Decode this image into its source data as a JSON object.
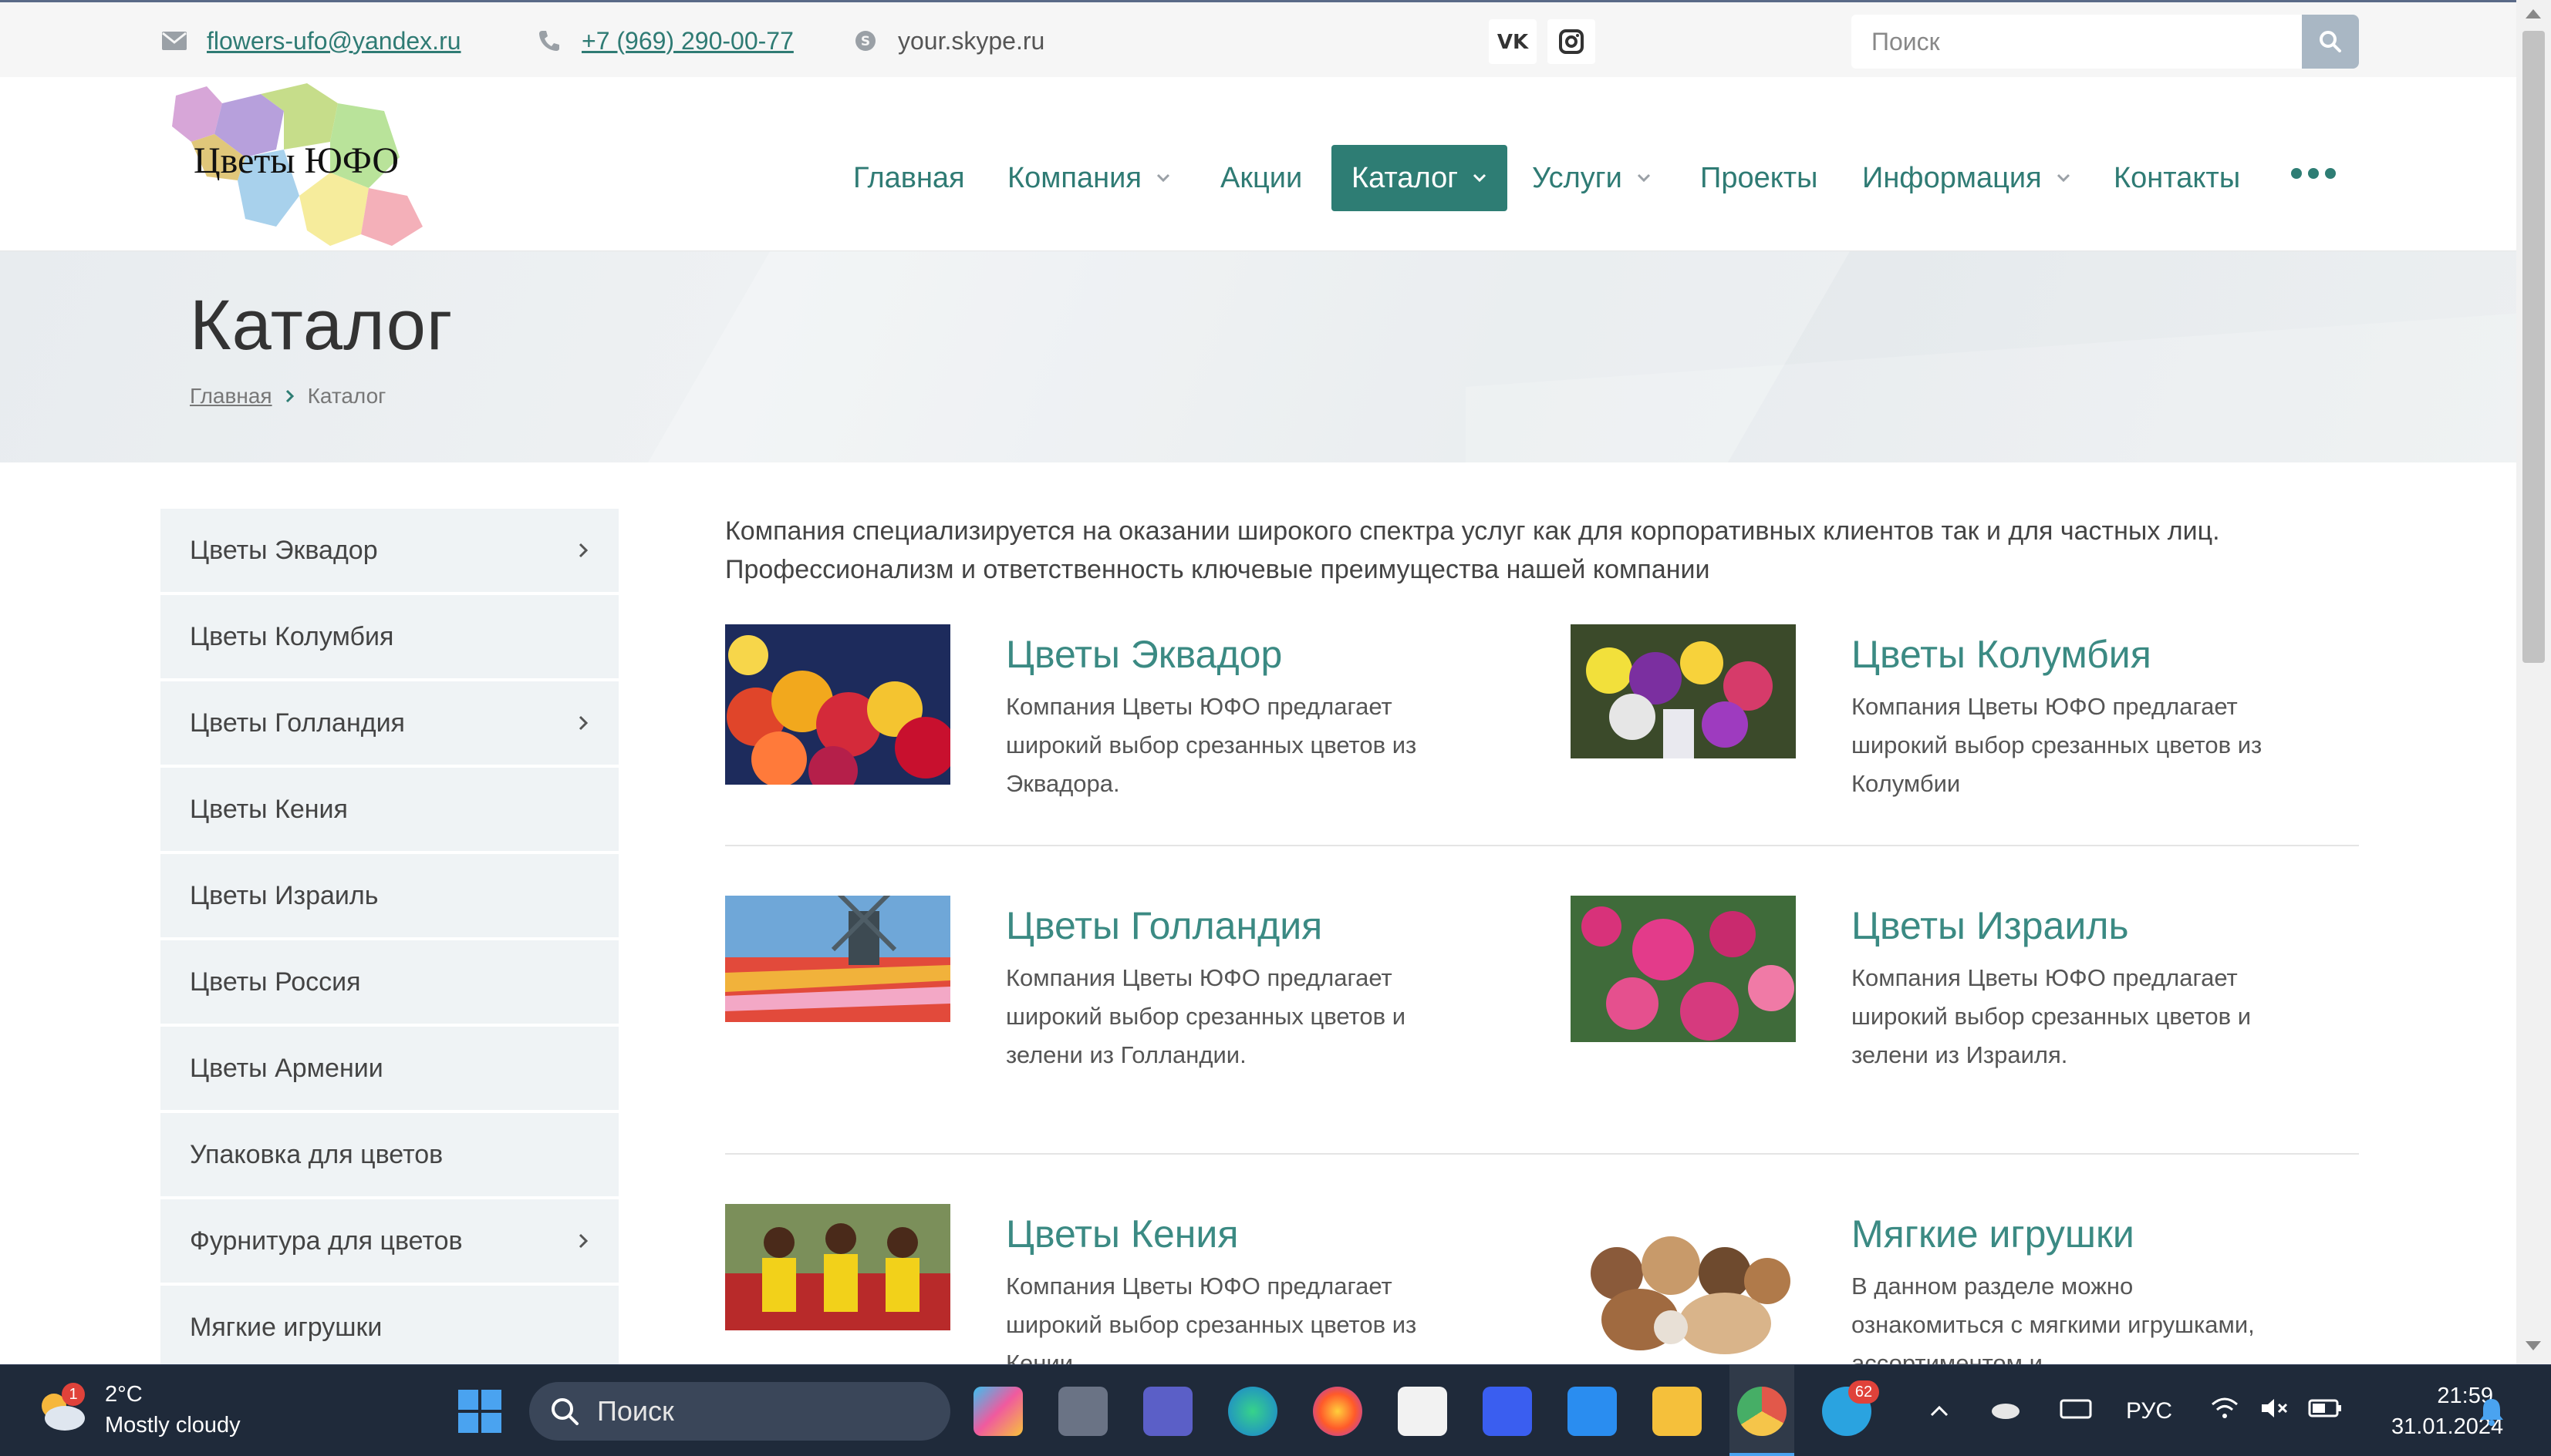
{
  "topbar": {
    "email": "flowers-ufo@yandex.ru",
    "phone": "+7 (969) 290-00-77",
    "skype": "your.skype.ru",
    "search_placeholder": "Поиск"
  },
  "logo_text": "Цветы ЮФО",
  "nav": {
    "items": [
      {
        "label": "Главная"
      },
      {
        "label": "Компания"
      },
      {
        "label": "Акции"
      },
      {
        "label": "Каталог"
      },
      {
        "label": "Услуги"
      },
      {
        "label": "Проекты"
      },
      {
        "label": "Информация"
      },
      {
        "label": "Контакты"
      }
    ]
  },
  "page": {
    "title": "Каталог",
    "breadcrumb_home": "Главная",
    "breadcrumb_current": "Каталог"
  },
  "sidebar": {
    "items": [
      {
        "label": "Цветы Эквадор"
      },
      {
        "label": "Цветы Колумбия"
      },
      {
        "label": "Цветы Голландия"
      },
      {
        "label": "Цветы Кения"
      },
      {
        "label": "Цветы Израиль"
      },
      {
        "label": "Цветы Россия"
      },
      {
        "label": "Цветы Армении"
      },
      {
        "label": "Упаковка для цветов"
      },
      {
        "label": "Фурнитура для цветов"
      },
      {
        "label": "Мягкие игрушки"
      }
    ]
  },
  "main": {
    "intro_line1": "Компания специализируется на оказании широкого спектра услуг как для корпоративных клиентов так и для частных лиц.",
    "intro_line2": "Профессионализм и ответственность ключевые преимущества нашей компании",
    "cards": [
      {
        "title": "Цветы Эквадор",
        "desc": "Компания Цветы ЮФО предлагает широкий выбор срезанных цветов из Эквадора."
      },
      {
        "title": "Цветы Колумбия",
        "desc": "Компания Цветы ЮФО предлагает широкий выбор срезанных цветов из Колумбии"
      },
      {
        "title": "Цветы Голландия",
        "desc": "Компания Цветы ЮФО предлагает широкий выбор срезанных цветов и зелени из Голландии."
      },
      {
        "title": "Цветы Израиль",
        "desc": "Компания Цветы ЮФО предлагает широкий выбор срезанных цветов и зелени из Израиля."
      },
      {
        "title": "Цветы Кения",
        "desc": "Компания Цветы ЮФО предлагает широкий выбор срезанных цветов из Кении"
      },
      {
        "title": "Мягкие игрушки",
        "desc": "В данном разделе можно ознакомиться с мягкими игрушками, ассортиментом и"
      }
    ]
  },
  "taskbar": {
    "weather_temp": "2°C",
    "weather_desc": "Mostly cloudy",
    "weather_badge": "1",
    "search_label": "Поиск",
    "telegram_badge": "62",
    "language": "РУС",
    "time": "21:59",
    "date": "31.01.2024"
  },
  "colors": {
    "accent": "#2e7d74",
    "link": "#2f7b74",
    "card_title": "#3b8a83",
    "sidebar_bg": "#eff3f5",
    "taskbar_bg": "#1f2a3a"
  },
  "icons": {
    "email": "envelope-icon",
    "phone": "phone-icon",
    "skype": "skype-icon",
    "vk": "vk-icon",
    "instagram": "instagram-icon",
    "search": "search-icon"
  }
}
